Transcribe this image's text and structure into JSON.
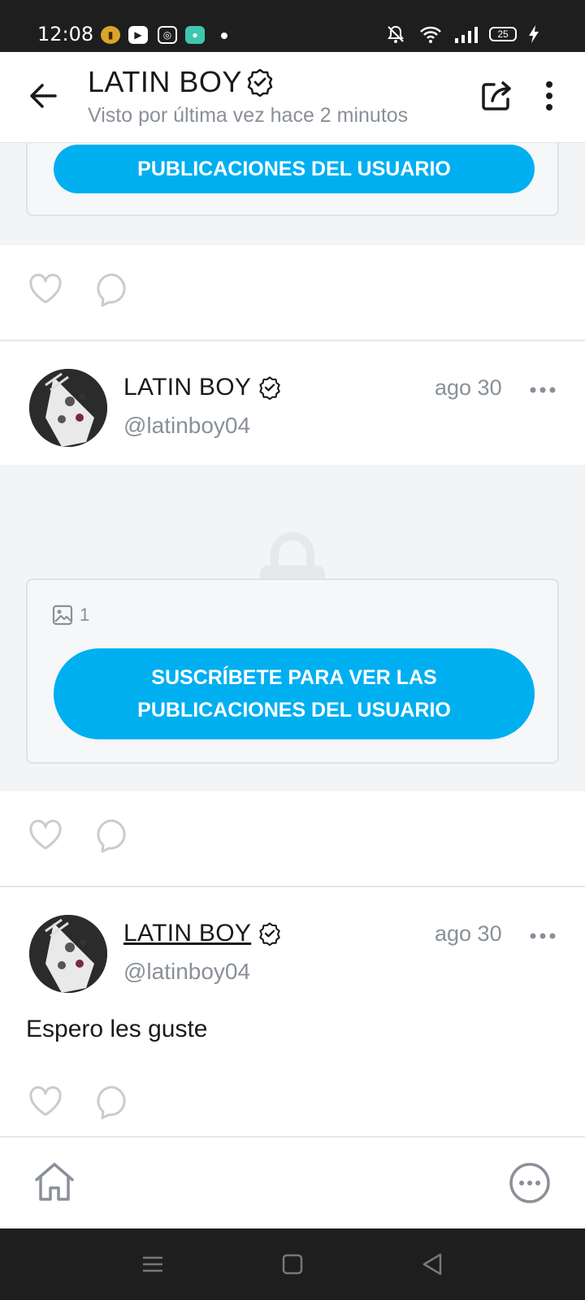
{
  "status_bar": {
    "time": "12:08",
    "battery_level": "25",
    "icons": [
      "notification-badge-icon",
      "youtube-icon",
      "instagram-icon",
      "app-icon",
      "mute-icon",
      "wifi-icon",
      "signal-icon",
      "battery-icon",
      "charging-icon"
    ]
  },
  "header": {
    "title": "LATIN BOY",
    "subtitle": "Visto por última vez hace 2 minutos"
  },
  "posts": [
    {
      "locked_button": "PUBLICACIONES DEL USUARIO"
    },
    {
      "name": "LATIN BOY",
      "handle": "@latinboy04",
      "date": "ago 30",
      "media_count": "1",
      "subscribe_button_line1": "SUSCRÍBETE PARA VER LAS",
      "subscribe_button_line2": "PUBLICACIONES DEL USUARIO"
    },
    {
      "name": "LATIN BOY",
      "handle": "@latinboy04",
      "date": "ago 30",
      "text": "Espero les guste"
    }
  ],
  "colors": {
    "accent": "#00aff0",
    "muted": "#8a9099",
    "locked_bg": "#f3f4f6"
  }
}
